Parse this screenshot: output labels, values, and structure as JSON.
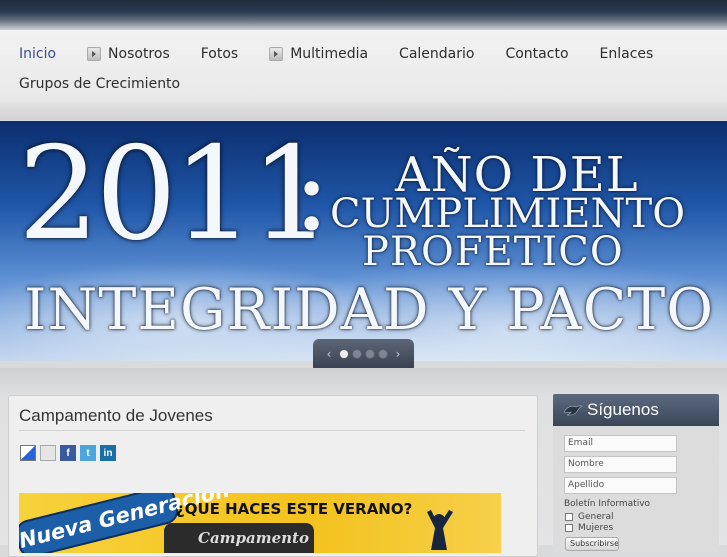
{
  "nav": {
    "row1": [
      {
        "label": "Inicio",
        "active": true,
        "has_submenu": false
      },
      {
        "label": "Nosotros",
        "active": false,
        "has_submenu": true
      },
      {
        "label": "Fotos",
        "active": false,
        "has_submenu": false
      },
      {
        "label": "Multimedia",
        "active": false,
        "has_submenu": true
      },
      {
        "label": "Calendario",
        "active": false,
        "has_submenu": false
      },
      {
        "label": "Contacto",
        "active": false,
        "has_submenu": false
      },
      {
        "label": "Enlaces",
        "active": false,
        "has_submenu": false
      }
    ],
    "row2": [
      {
        "label": "Grupos de Crecimiento",
        "active": false,
        "has_submenu": false
      }
    ]
  },
  "banner": {
    "year": "2011",
    "colon": ":",
    "line1": "AÑO DEL",
    "line2": "CUMPLIMIENTO",
    "line3": "PROFETICO",
    "motto": "INTEGRIDAD Y PACTO",
    "slider": {
      "prev": "‹",
      "next": "›",
      "dot_count": 4,
      "active_dot": 0
    }
  },
  "post": {
    "title": "Campamento de Jovenes",
    "share_icons": [
      "delicious-icon",
      "digg-icon",
      "facebook-icon",
      "twitter-icon",
      "linkedin-icon"
    ],
    "share_glyphs": {
      "facebook": "f",
      "twitter": "t",
      "linkedin": "in"
    },
    "promo": {
      "badge": "Nueva Generación",
      "question": "¿QUE HACES ESTE VERANO?",
      "camp_text": "Campamento"
    }
  },
  "sidebar": {
    "title": "Síguenos",
    "fields": [
      {
        "placeholder": "Email"
      },
      {
        "placeholder": "Nombre"
      },
      {
        "placeholder": "Apellido"
      }
    ],
    "newsletter_label": "Boletín Informativo",
    "options": [
      "General",
      "Mujeres"
    ],
    "button_label": "Subscribirse"
  },
  "colors": {
    "nav_active": "#3b4f8f",
    "sidebar_header": "#4a566b",
    "banner_sky": "#1f56a8",
    "promo_yellow": "#f4c21e"
  }
}
